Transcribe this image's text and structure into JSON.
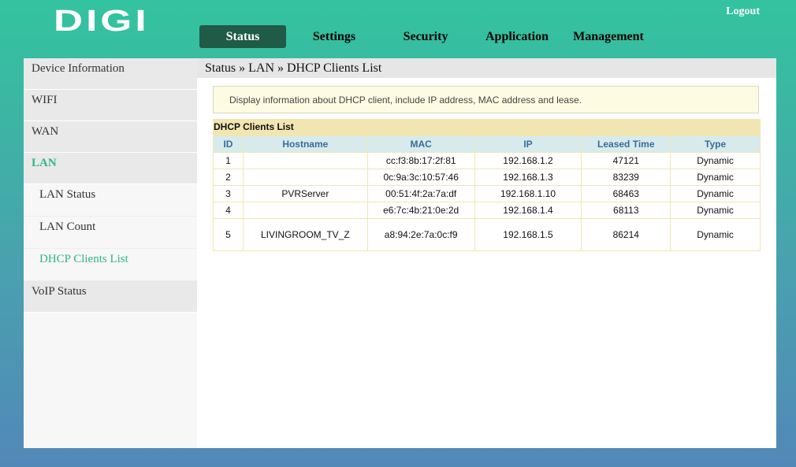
{
  "header": {
    "logo": "DIGI",
    "logout": "Logout"
  },
  "nav": {
    "tabs": [
      {
        "label": "Status"
      },
      {
        "label": "Settings"
      },
      {
        "label": "Security"
      },
      {
        "label": "Application"
      },
      {
        "label": "Management"
      }
    ]
  },
  "sidebar": {
    "items": [
      {
        "label": "Device Information"
      },
      {
        "label": "WIFI"
      },
      {
        "label": "WAN"
      },
      {
        "label": "LAN"
      },
      {
        "label": "VoIP Status"
      }
    ],
    "lan_sub": [
      {
        "label": "LAN Status"
      },
      {
        "label": "LAN Count"
      },
      {
        "label": "DHCP Clients List"
      }
    ]
  },
  "main": {
    "breadcrumb": "Status » LAN » DHCP Clients List",
    "info": "Display information about DHCP client, include IP address, MAC address and lease.",
    "table_title": "DHCP Clients List",
    "columns": [
      "ID",
      "Hostname",
      "MAC",
      "IP",
      "Leased Time",
      "Type"
    ],
    "rows": [
      {
        "id": "1",
        "hostname": "",
        "mac": "cc:f3:8b:17:2f:81",
        "ip": "192.168.1.2",
        "leased": "47121",
        "type": "Dynamic"
      },
      {
        "id": "2",
        "hostname": "",
        "mac": "0c:9a:3c:10:57:46",
        "ip": "192.168.1.3",
        "leased": "83239",
        "type": "Dynamic"
      },
      {
        "id": "3",
        "hostname": "PVRServer",
        "mac": "00:51:4f:2a:7a:df",
        "ip": "192.168.1.10",
        "leased": "68463",
        "type": "Dynamic"
      },
      {
        "id": "4",
        "hostname": "",
        "mac": "e6:7c:4b:21:0e:2d",
        "ip": "192.168.1.4",
        "leased": "68113",
        "type": "Dynamic"
      },
      {
        "id": "5",
        "hostname": "LIVINGROOM_TV_Z",
        "mac": "a8:94:2e:7a:0c:f9",
        "ip": "192.168.1.5",
        "leased": "86214",
        "type": "Dynamic"
      }
    ]
  }
}
